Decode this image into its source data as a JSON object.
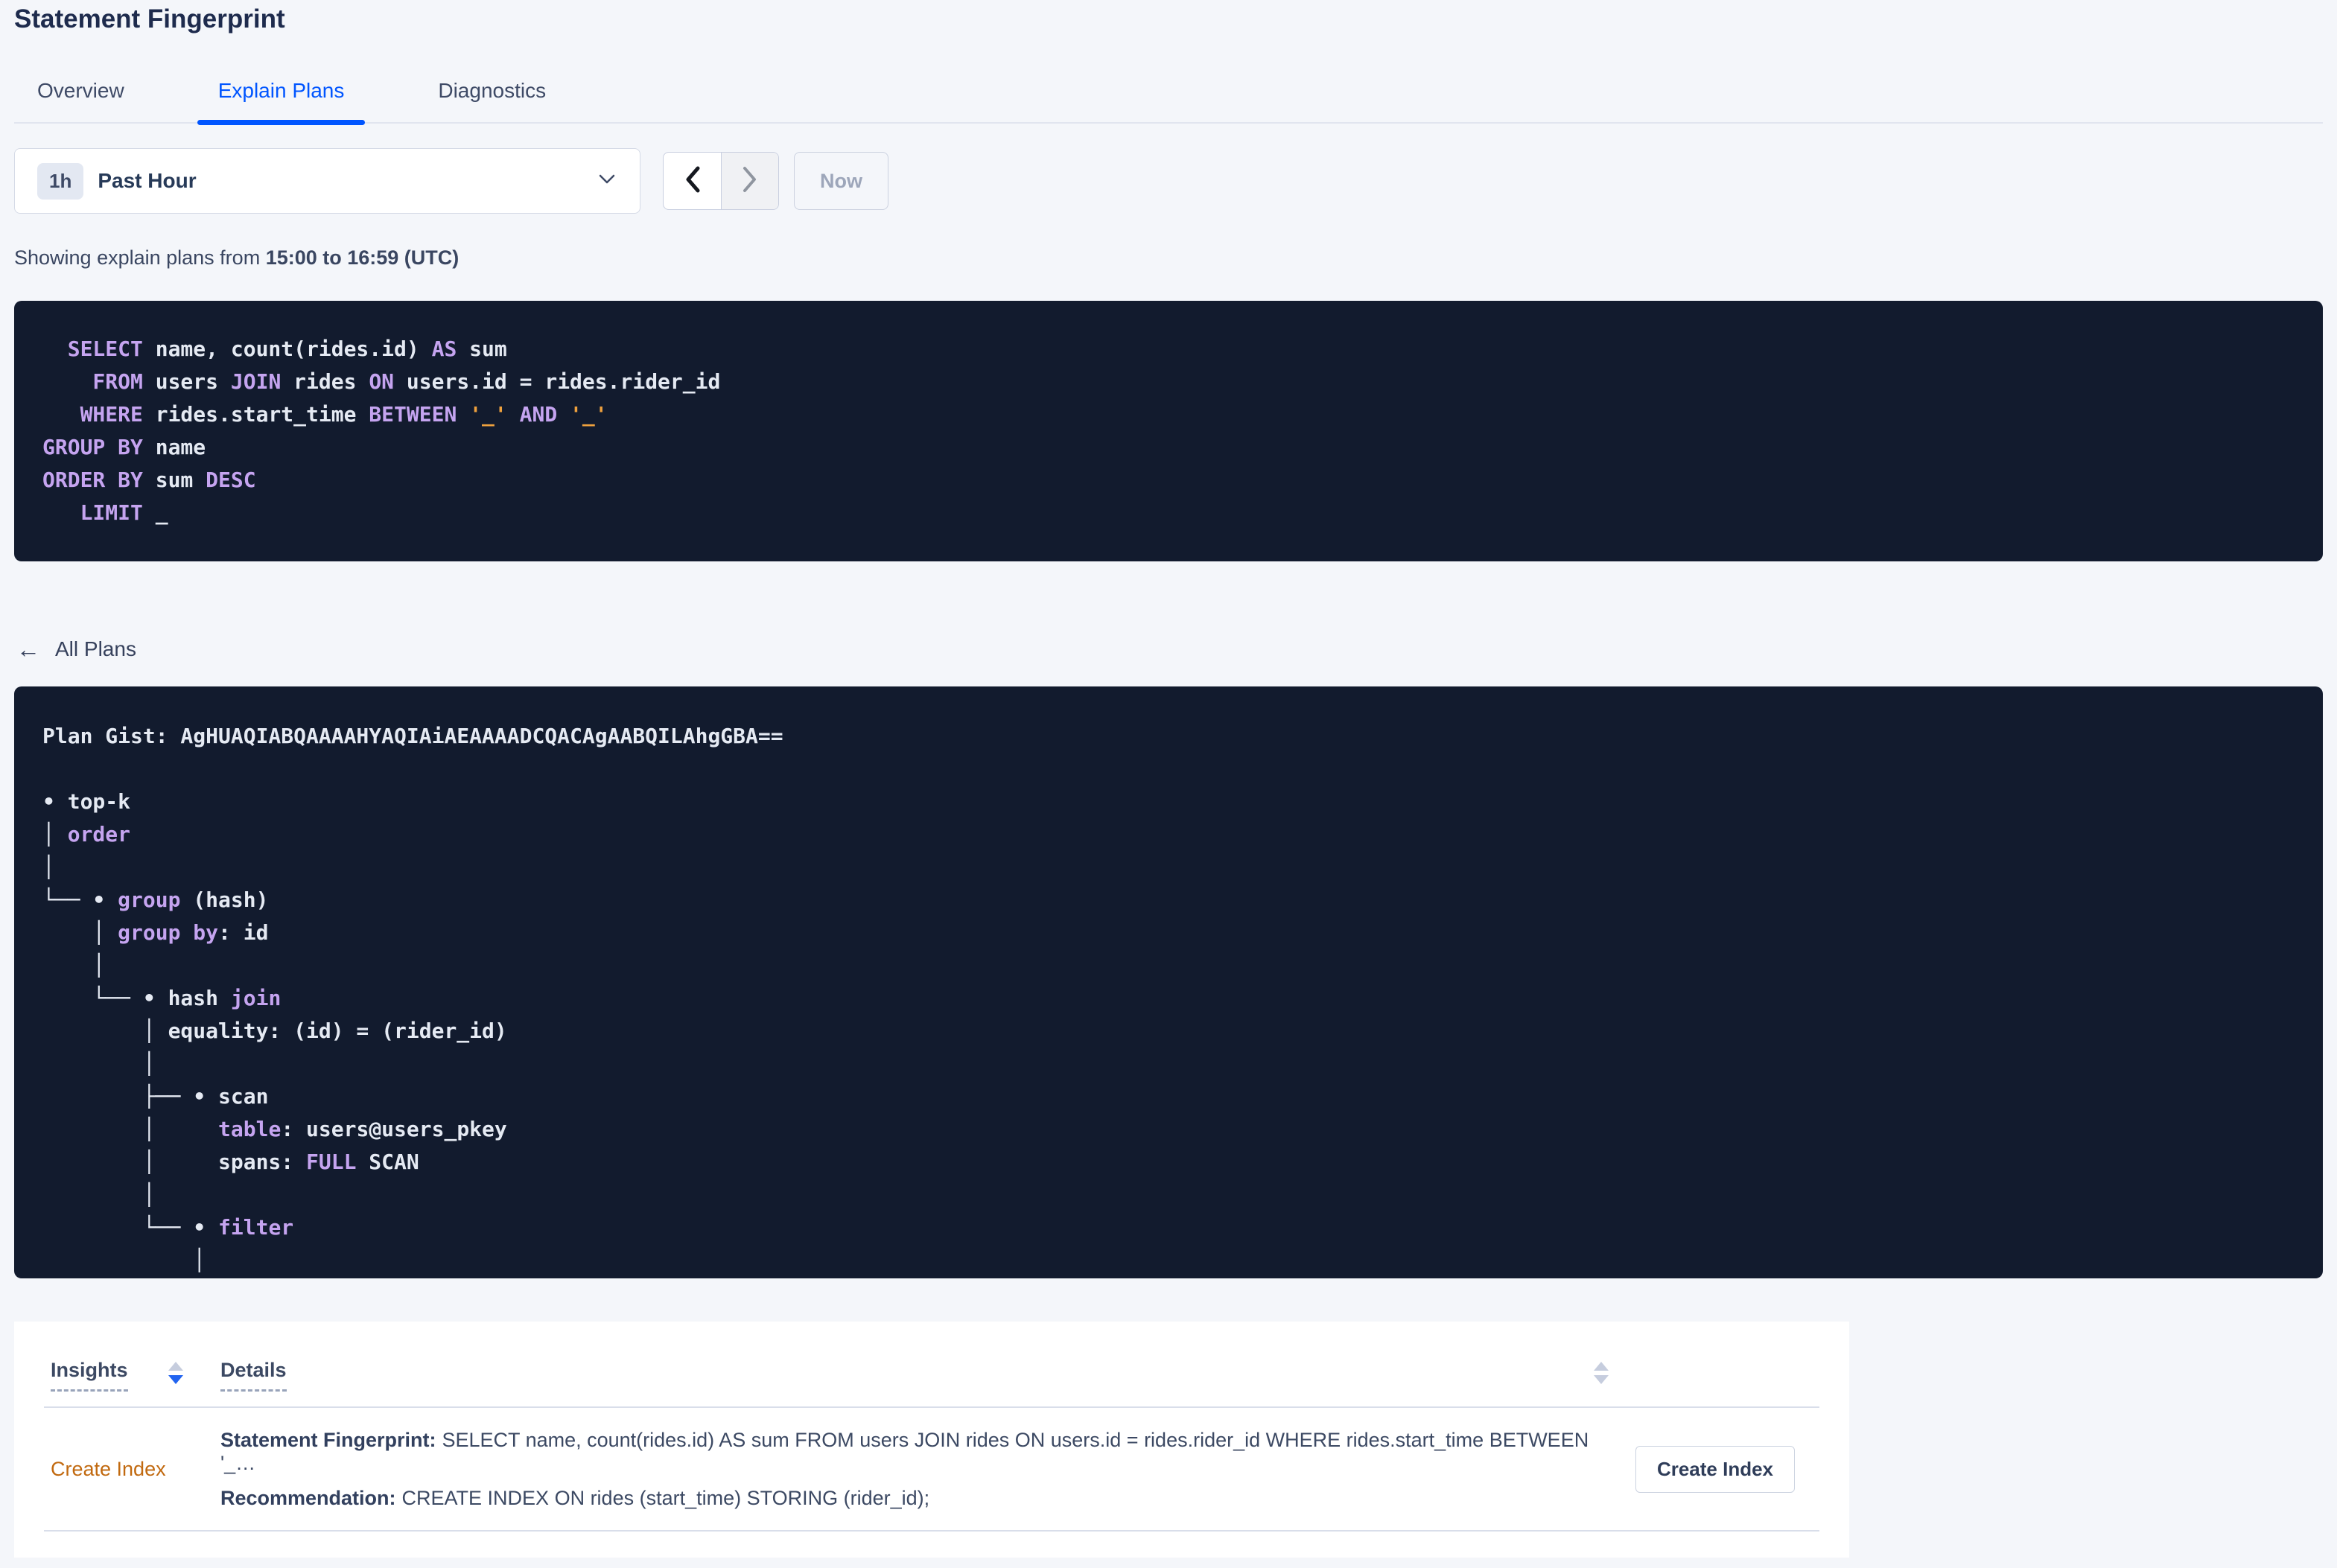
{
  "page": {
    "title": "Statement Fingerprint"
  },
  "tabs": [
    {
      "label": "Overview",
      "active": false
    },
    {
      "label": "Explain Plans",
      "active": true
    },
    {
      "label": "Diagnostics",
      "active": false
    }
  ],
  "time_picker": {
    "range_badge": "1h",
    "range_label": "Past Hour",
    "now_button": "Now"
  },
  "subtitle": {
    "prefix": "Showing explain plans from ",
    "bold_range": "15:00 to 16:59 (UTC)"
  },
  "sql": {
    "lines": [
      [
        {
          "c": "kw",
          "t": "  SELECT"
        },
        {
          "c": "pl",
          "t": " name, count(rides.id) "
        },
        {
          "c": "kw",
          "t": "AS"
        },
        {
          "c": "pl",
          "t": " sum"
        }
      ],
      [
        {
          "c": "kw",
          "t": "    FROM"
        },
        {
          "c": "pl",
          "t": " users "
        },
        {
          "c": "kw",
          "t": "JOIN"
        },
        {
          "c": "pl",
          "t": " rides "
        },
        {
          "c": "kw",
          "t": "ON"
        },
        {
          "c": "pl",
          "t": " users.id = rides.rider_id"
        }
      ],
      [
        {
          "c": "kw",
          "t": "   WHERE"
        },
        {
          "c": "pl",
          "t": " rides.start_time "
        },
        {
          "c": "kw",
          "t": "BETWEEN"
        },
        {
          "c": "pl",
          "t": " "
        },
        {
          "c": "st",
          "t": "'_'"
        },
        {
          "c": "pl",
          "t": " "
        },
        {
          "c": "kw",
          "t": "AND"
        },
        {
          "c": "pl",
          "t": " "
        },
        {
          "c": "st",
          "t": "'_'"
        }
      ],
      [
        {
          "c": "kw",
          "t": "GROUP BY"
        },
        {
          "c": "pl",
          "t": " name"
        }
      ],
      [
        {
          "c": "kw",
          "t": "ORDER BY"
        },
        {
          "c": "pl",
          "t": " sum "
        },
        {
          "c": "kw",
          "t": "DESC"
        }
      ],
      [
        {
          "c": "kw",
          "t": "   LIMIT"
        },
        {
          "c": "pl",
          "t": " _"
        }
      ]
    ]
  },
  "plans_nav": {
    "back_label": "All Plans"
  },
  "plan": {
    "gist_line": "Plan Gist: AgHUAQIABQAAAAHYAQIAiAEAAAADCQACAgAABQILAhgGBA==",
    "tree_lines": [
      [
        {
          "c": "pl",
          "t": "• top-k"
        }
      ],
      [
        {
          "c": "pl",
          "t": "│ "
        },
        {
          "c": "kw",
          "t": "order"
        }
      ],
      [
        {
          "c": "pl",
          "t": "│"
        }
      ],
      [
        {
          "c": "pl",
          "t": "└── • "
        },
        {
          "c": "kw",
          "t": "group"
        },
        {
          "c": "pl",
          "t": " (hash)"
        }
      ],
      [
        {
          "c": "pl",
          "t": "    │ "
        },
        {
          "c": "kw",
          "t": "group by"
        },
        {
          "c": "pl",
          "t": ": id"
        }
      ],
      [
        {
          "c": "pl",
          "t": "    │"
        }
      ],
      [
        {
          "c": "pl",
          "t": "    └── • hash "
        },
        {
          "c": "kw",
          "t": "join"
        }
      ],
      [
        {
          "c": "pl",
          "t": "        │ equality: (id) = (rider_id)"
        }
      ],
      [
        {
          "c": "pl",
          "t": "        │"
        }
      ],
      [
        {
          "c": "pl",
          "t": "        ├── • scan"
        }
      ],
      [
        {
          "c": "pl",
          "t": "        │     "
        },
        {
          "c": "kw",
          "t": "table"
        },
        {
          "c": "pl",
          "t": ": users@users_pkey"
        }
      ],
      [
        {
          "c": "pl",
          "t": "        │     spans: "
        },
        {
          "c": "kw",
          "t": "FULL"
        },
        {
          "c": "pl",
          "t": " SCAN"
        }
      ],
      [
        {
          "c": "pl",
          "t": "        │"
        }
      ],
      [
        {
          "c": "pl",
          "t": "        └── • "
        },
        {
          "c": "kw",
          "t": "filter"
        }
      ],
      [
        {
          "c": "pl",
          "t": "            │"
        }
      ]
    ]
  },
  "insights_table": {
    "headers": {
      "insights": "Insights",
      "details": "Details"
    },
    "row": {
      "insight_link": "Create Index",
      "fingerprint_label": "Statement Fingerprint:",
      "fingerprint_text": "SELECT name, count(rides.id) AS sum FROM users JOIN rides ON users.id = rides.rider_id WHERE rides.start_time BETWEEN '_…",
      "recommendation_label": "Recommendation:",
      "recommendation_text": "CREATE INDEX ON rides (start_time) STORING (rider_id);",
      "action_button": "Create Index"
    }
  },
  "icons": {
    "back_arrow": "←"
  },
  "colors": {
    "accent_blue": "#0055ff",
    "panel_bg": "#121b2e",
    "code_keyword": "#c5a4f0",
    "code_plain": "#e5eaf3",
    "code_string": "#eea13e",
    "insight_link": "#c1690f",
    "sort_active": "#2264f0"
  }
}
